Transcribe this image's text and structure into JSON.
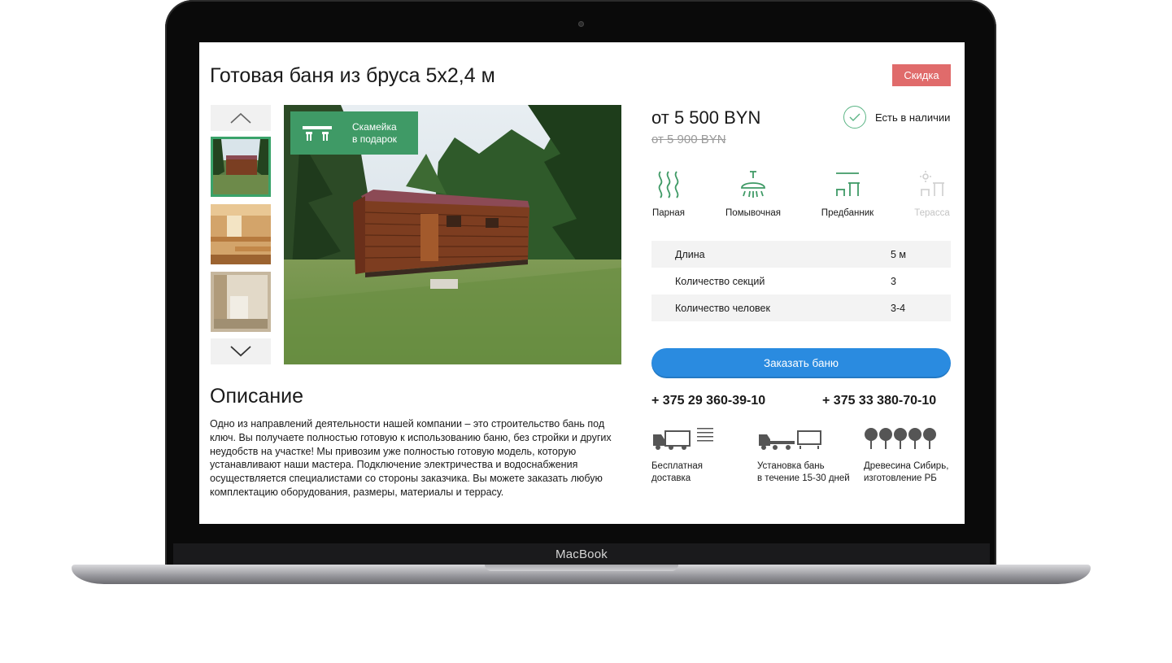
{
  "device": {
    "brand": "MacBook"
  },
  "product": {
    "title": "Готовая баня из бруса 5х2,4 м",
    "badge": "Скидка",
    "gift_line1": "Скамейка",
    "gift_line2": "в подарок"
  },
  "pricing": {
    "price": "от 5 500 BYN",
    "old_price": "от 5 900 BYN",
    "availability": "Есть в наличии"
  },
  "features": [
    {
      "label": "Парная",
      "icon": "steam-icon",
      "enabled": true
    },
    {
      "label": "Помывочная",
      "icon": "shower-icon",
      "enabled": true
    },
    {
      "label": "Предбанник",
      "icon": "bench-table-icon",
      "enabled": true
    },
    {
      "label": "Терасса",
      "icon": "terrace-icon",
      "enabled": false
    }
  ],
  "specs": [
    {
      "key": "Длина",
      "value": "5 м"
    },
    {
      "key": "Количество секций",
      "value": "3"
    },
    {
      "key": "Количество человек",
      "value": "3-4"
    }
  ],
  "order_button": "Заказать баню",
  "phones": [
    "+ 375 29 360-39-10",
    "+ 375 33 380-70-10"
  ],
  "benefits": [
    {
      "line1": "Бесплатная",
      "line2": "доставка",
      "icon": "delivery-truck-icon"
    },
    {
      "line1": "Установка бань",
      "line2": "в течение 15-30 дней",
      "icon": "tow-truck-icon"
    },
    {
      "line1": "Древесина Сибирь,",
      "line2": "изготовление РБ",
      "icon": "trees-icon"
    }
  ],
  "description": {
    "title": "Описание",
    "text": "Одно из направлений деятельности нашей компании – это строительство бань под ключ. Вы получаете полностью готовую к использованию баню, без стройки и других неудобств на участке! Мы привозим уже полностью готовую модель, которую устанавливают наши мастера. Подключение электричества и водоснабжения осуществляется специалистами со стороны заказчика. Вы можете заказать любую комплектацию оборудования, размеры, материалы и террасу."
  },
  "colors": {
    "accent_green": "#3f9a66",
    "badge_red": "#e06b6b",
    "button_blue": "#2a8be0"
  }
}
